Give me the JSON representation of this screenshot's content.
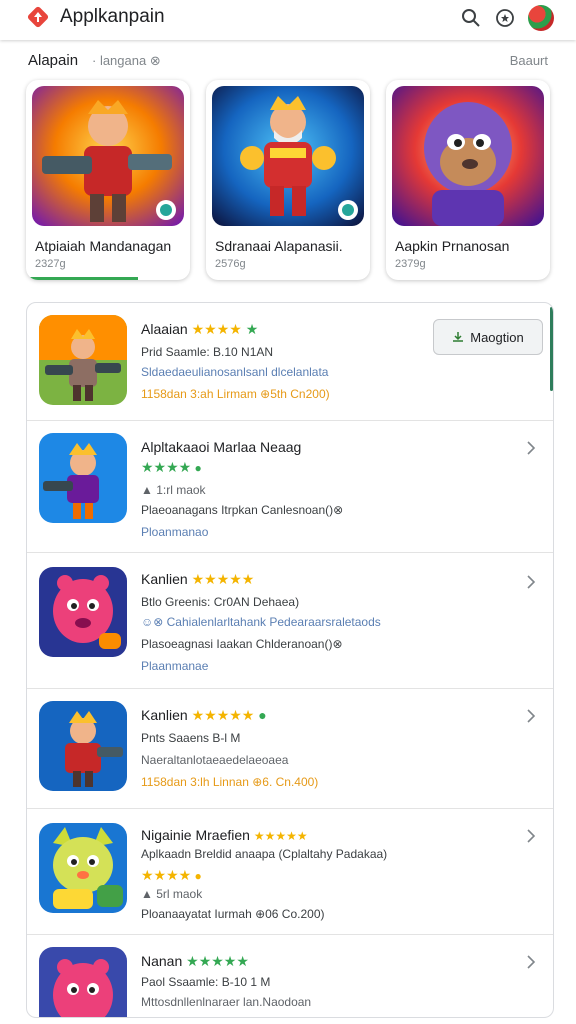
{
  "app_bar": {
    "title": "Applkanpain",
    "icons": [
      "app-logo-icon",
      "search-icon",
      "rating-icon",
      "account-avatar"
    ]
  },
  "section": {
    "title": "Alapain",
    "subtitle": "· langana ⊗",
    "more": "Baaurt"
  },
  "featured": [
    {
      "name": "Atpiaiah Mandanagan",
      "size": "2327g",
      "progress": 0.68
    },
    {
      "name": "Sdranaai Alapanasii.",
      "size": "2576g"
    },
    {
      "name": "Aapkin Prnanosan",
      "size": "2379g"
    }
  ],
  "list": [
    {
      "title": "Alaaian",
      "stars": "★★★★",
      "line1": "Prid Saamle: B.10 N1AN",
      "line2": "Sldaedaeulianosanlsanl dlcelanlata",
      "line3": "1158dan 3:ah  Lirmam  ⊕5th  Cn200)",
      "button": "Maogtion"
    },
    {
      "title": "Alpltakaaoi Marlaa Neaag",
      "stars": "★★★★",
      "line1": "▲ 1:rl maok",
      "line2": "Plaeoanagans  Itrpkan Canlesnoan()⊗",
      "line3": "Ploanmanao"
    },
    {
      "title": "Kanlien",
      "stars": "★★★★★",
      "line1": "Btlo Greenis: Cr0AN Dehaea)",
      "line2": "☺⊗ Cahialenlarltahank Pedearaarsraletaods",
      "line3": "Plasoeagnasi Iaakan Chlderanoan()⊗",
      "line4": "Plaanmanae"
    },
    {
      "title": "Kanlien",
      "stars": "★★★★★",
      "line1": "Pnts Saaens B-l M",
      "line2": "Naeraltanlotaeaedelaeoaea",
      "line3": "1158dan 3:lh  Linnan ⊕6.  Cn.400)"
    },
    {
      "title": "Nigainie Mraefien",
      "stars": "★★★★★",
      "line1": "Aplkaadn  Breldid anaapa (Cplaltahy Padakaa)",
      "line2": "▲ 5rl maok",
      "line3": "Ploanaayatat Iurmah ⊕06  Co.200)"
    },
    {
      "title": "Nanan",
      "stars": "★★★★★",
      "line1": "Paol Ssaamle: B-10 1 M",
      "line2": "Mttosdnllenlnaraer lan.Naodoan"
    }
  ],
  "colors": {
    "accent_green": "#34a853",
    "star_yellow": "#f4b400",
    "link_blue": "#5b7fb3",
    "orange_text": "#e69a18"
  }
}
